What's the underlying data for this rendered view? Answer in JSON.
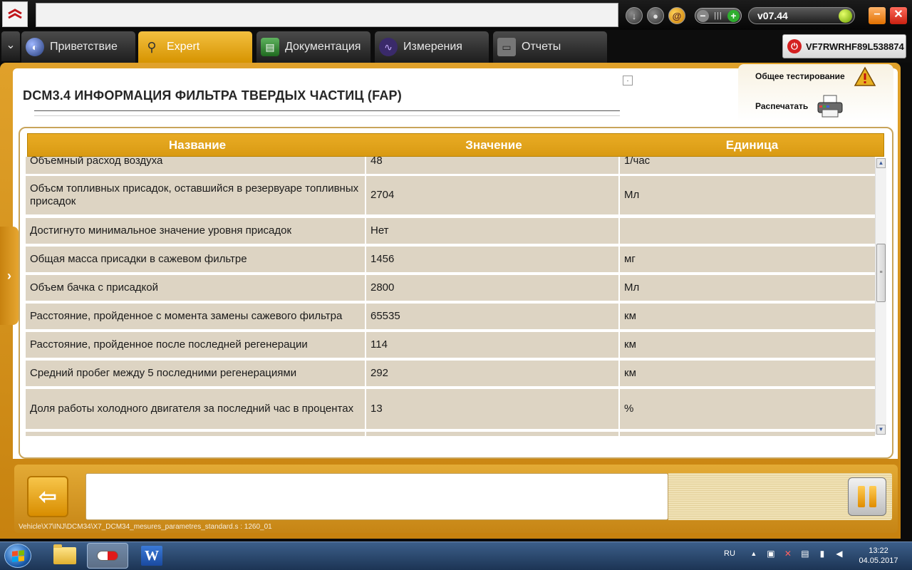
{
  "tabs": [
    {
      "label": "Приветствие",
      "icon": "globe-icon"
    },
    {
      "label": "Expert",
      "icon": "magnifier-icon"
    },
    {
      "label": "Документация",
      "icon": "book-icon"
    },
    {
      "label": "Измерения",
      "icon": "waveform-icon"
    },
    {
      "label": "Отчеты",
      "icon": "document-icon"
    }
  ],
  "version": "v07.44",
  "vin": "VF7RWRHF89L538874",
  "page": {
    "title": "DCM3.4  ИНФОРМАЦИЯ ФИЛЬТРА ТВЕРДЫХ ЧАСТИЦ (FAP)",
    "checkbox_glyph": "·"
  },
  "side_actions": {
    "general_test": "Общее тестирование",
    "print": "Распечатать"
  },
  "table": {
    "headers": {
      "name": "Название",
      "value": "Значение",
      "unit": "Единица"
    },
    "rows": [
      {
        "name": "Объемный расход воздуха",
        "value": "48",
        "unit": "1/час"
      },
      {
        "name": "Объсм топливных присадок, оставшийся в резервуаре топливных присадок",
        "value": "2704",
        "unit": "Мл"
      },
      {
        "name": "Достигнуто минимальное значение уровня присадок",
        "value": "Нет",
        "unit": ""
      },
      {
        "name": "Общая масса присадки в сажевом фильтре",
        "value": "1456",
        "unit": "мг"
      },
      {
        "name": "Объем бачка с присадкой",
        "value": "2800",
        "unit": "Мл"
      },
      {
        "name": "Расстояние, пройденное с момента замены сажевого фильтра",
        "value": "65535",
        "unit": "км"
      },
      {
        "name": "Расстояние, пройденное после последней регенерации",
        "value": "114",
        "unit": "км"
      },
      {
        "name": "Средний пробег между 5 последними регенерациями",
        "value": "292",
        "unit": "км"
      },
      {
        "name": "Доля работы холодного двигателя за последний час в процентах",
        "value": "13",
        "unit": "%"
      },
      {
        "name": "",
        "value": "",
        "unit": ""
      }
    ]
  },
  "footer": {
    "script_path": "Vehicle\\X7\\INJ\\DCM34\\X7_DCM34_mesures_parametres_standard.s : 1260_01"
  },
  "taskbar": {
    "language": "RU",
    "time": "13:22",
    "date": "04.05.2017"
  },
  "colors": {
    "accent": "#d99a12",
    "row_bg": "#ddd4c3",
    "taskbar": "#1c3454"
  }
}
